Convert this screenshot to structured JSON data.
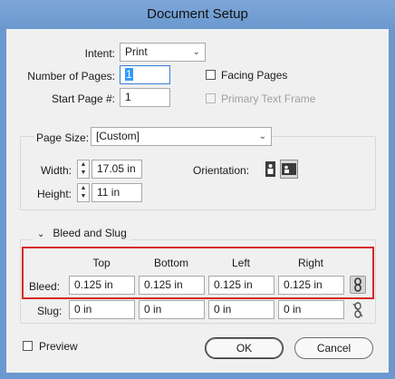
{
  "window": {
    "title": "Document Setup"
  },
  "intent": {
    "label": "Intent:",
    "value": "Print"
  },
  "pages": {
    "number_label": "Number of Pages:",
    "number_value": "1",
    "start_label": "Start Page #:",
    "start_value": "1",
    "facing_label": "Facing Pages",
    "facing_checked": false,
    "primary_label": "Primary Text Frame",
    "primary_checked": false
  },
  "page_size": {
    "label": "Page Size:",
    "value": "[Custom]",
    "width_label": "Width:",
    "width_value": "17.05 in",
    "height_label": "Height:",
    "height_value": "11 in",
    "orientation_label": "Orientation:",
    "orientation_selected": "landscape"
  },
  "bleed_slug": {
    "title": "Bleed and Slug",
    "columns": [
      "Top",
      "Bottom",
      "Left",
      "Right"
    ],
    "bleed_label": "Bleed:",
    "bleed_values": [
      "0.125 in",
      "0.125 in",
      "0.125 in",
      "0.125 in"
    ],
    "bleed_linked": true,
    "slug_label": "Slug:",
    "slug_values": [
      "0 in",
      "0 in",
      "0 in",
      "0 in"
    ],
    "slug_linked": false
  },
  "footer": {
    "preview_label": "Preview",
    "preview_checked": false,
    "ok_label": "OK",
    "cancel_label": "Cancel"
  },
  "colors": {
    "highlight": "#d9252a",
    "titlebar": "#6a98cf",
    "selection": "#3399ff"
  }
}
